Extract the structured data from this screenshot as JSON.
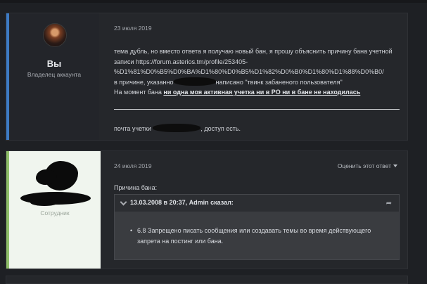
{
  "post1": {
    "author_name": "Вы",
    "author_role": "Владелец аккаунта",
    "date": "23 июля 2019",
    "lines": {
      "l1": "тема дубль, но вместо ответа я получаю новый бан, я прошу объяснить причину бана учетной",
      "l2": "записи https://forum.asterios.tm/profile/253405-",
      "l3": "%D1%81%D0%B5%D0%BA%D1%80%D0%B5%D1%82%D0%B0%D1%80%D1%88%D0%B0/",
      "l4_a": "в причине, указанно",
      "l4_b": "написано \"твинк забаненого пользователя\"",
      "l5_a": "На момент бана ",
      "l5_b": "ни одна моя активная учетка ни в РО ни в бане не находилась"
    },
    "mail_a": "почта учетки ",
    "mail_b": ", доступ есть."
  },
  "post2": {
    "staff_role": "Сотрудник",
    "date": "24 июля 2019",
    "rate_label": "Оценить этот ответ",
    "reason_label": "Причина бана:",
    "quote_header": "13.03.2008 в 20:37, Admin сказал:",
    "quote_items": [
      "6.8 Запрещено писать сообщения или создавать темы во время действующего запрета на постинг или бана."
    ]
  },
  "colors": {
    "accent_owner": "#3d7bc4",
    "accent_staff": "#8fbf6a",
    "background": "#1e2024"
  },
  "icons": {
    "quote_collapse": "chevron-down-icon",
    "quote_share": "share-arrow-icon",
    "rate_caret": "caret-down-icon"
  }
}
